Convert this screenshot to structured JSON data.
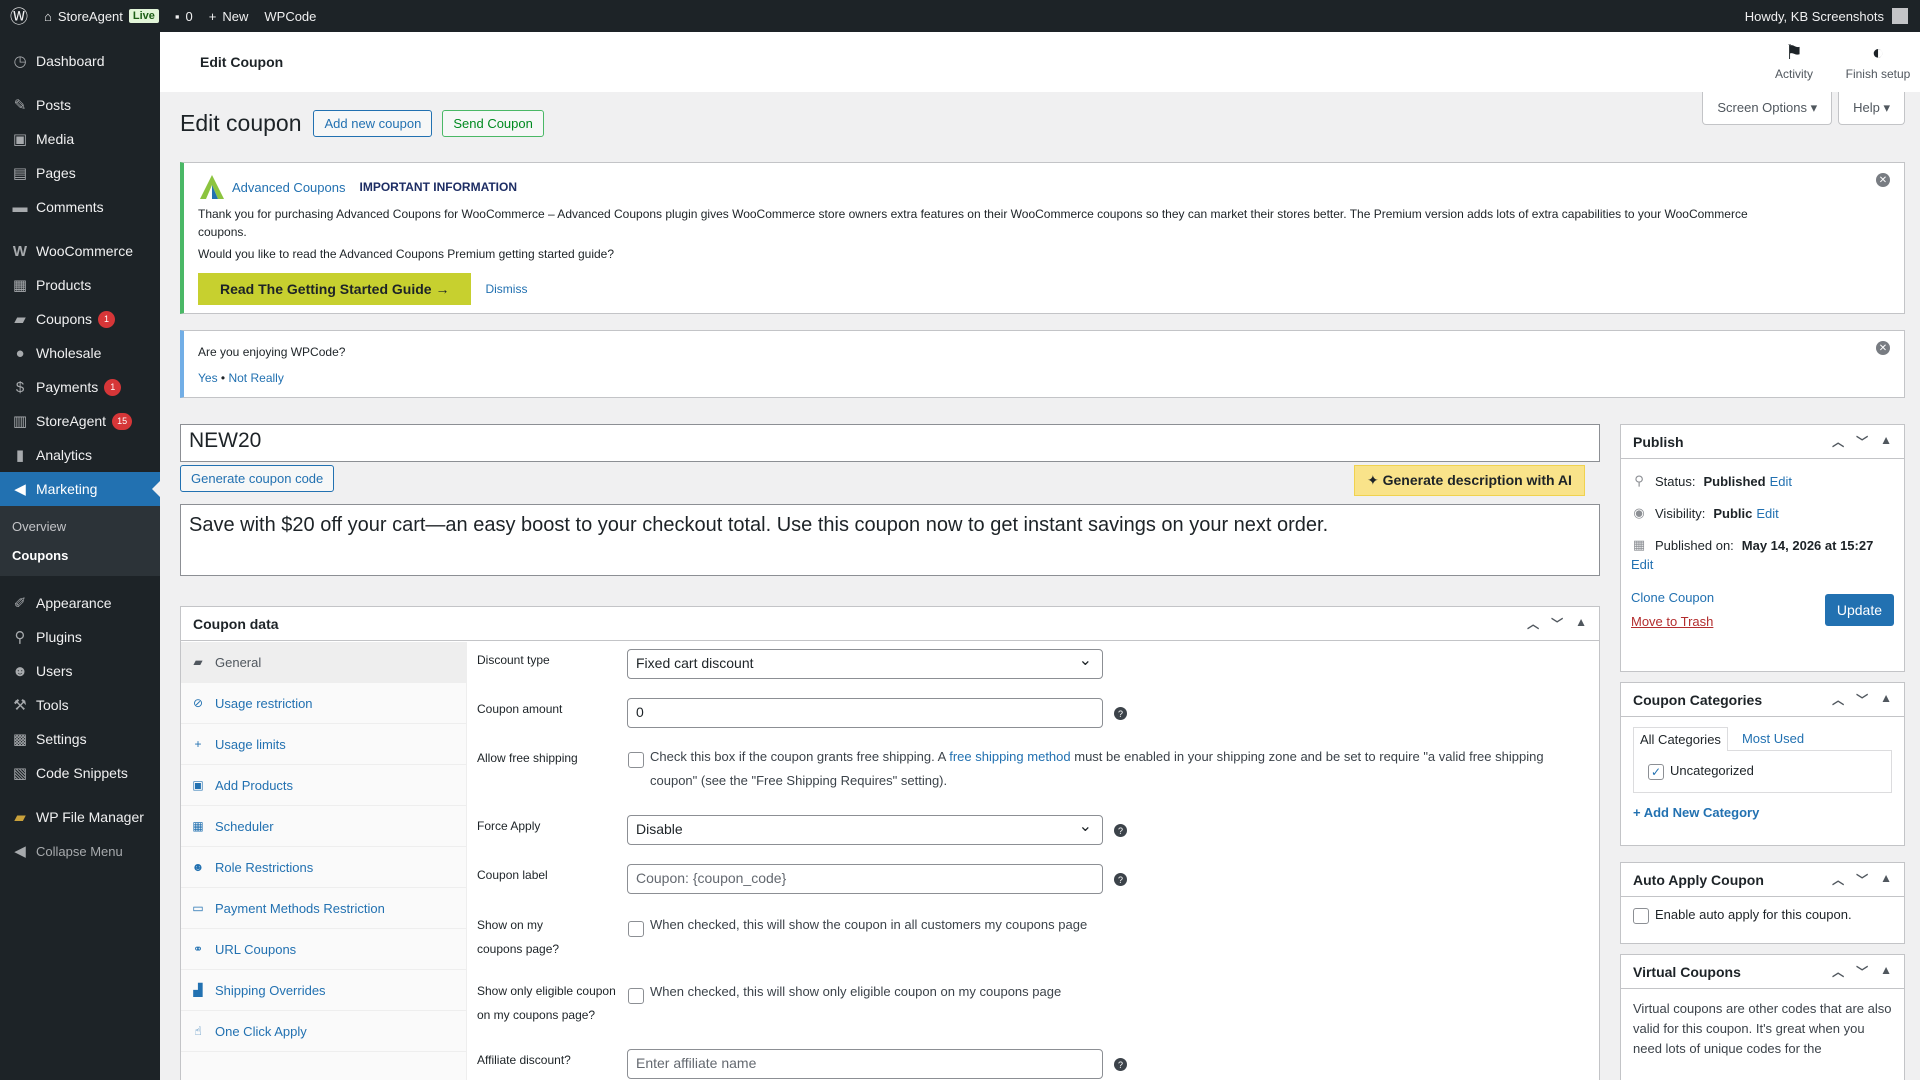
{
  "adminbar": {
    "site_name": "StoreAgent",
    "live_label": "Live",
    "comments_count": "0",
    "new_label": "New",
    "wpcode_label": "WPCode",
    "greeting": "Howdy, KB Screenshots"
  },
  "sidebar": {
    "items": [
      {
        "label": "Dashboard",
        "icon": "dashboard-icon"
      },
      {
        "label": "Posts",
        "icon": "pin-icon"
      },
      {
        "label": "Media",
        "icon": "media-icon"
      },
      {
        "label": "Pages",
        "icon": "page-icon"
      },
      {
        "label": "Comments",
        "icon": "comment-icon"
      },
      {
        "label": "WooCommerce",
        "icon": "woo-icon"
      },
      {
        "label": "Products",
        "icon": "archive-icon"
      },
      {
        "label": "Coupons",
        "icon": "ticket-icon",
        "badge": "1"
      },
      {
        "label": "Wholesale",
        "icon": "wholesale-icon"
      },
      {
        "label": "Payments",
        "icon": "dollar-icon",
        "badge": "1"
      },
      {
        "label": "StoreAgent",
        "icon": "store-icon",
        "badge": "15"
      },
      {
        "label": "Analytics",
        "icon": "bar-chart-icon"
      },
      {
        "label": "Marketing",
        "icon": "megaphone-icon"
      },
      {
        "label": "Appearance",
        "icon": "brush-icon"
      },
      {
        "label": "Plugins",
        "icon": "plug-icon"
      },
      {
        "label": "Users",
        "icon": "user-icon"
      },
      {
        "label": "Tools",
        "icon": "wrench-icon"
      },
      {
        "label": "Settings",
        "icon": "settings-icon"
      },
      {
        "label": "Code Snippets",
        "icon": "code-icon"
      },
      {
        "label": "WP File Manager",
        "icon": "folder-icon"
      },
      {
        "label": "Collapse Menu",
        "icon": "collapse-icon"
      }
    ],
    "submenu": [
      "Overview",
      "Coupons"
    ]
  },
  "header": {
    "title": "Edit Coupon",
    "activity": "Activity",
    "finish_setup": "Finish setup"
  },
  "screen_options": "Screen Options",
  "help": "Help",
  "heading": {
    "title": "Edit coupon",
    "add_new": "Add new coupon",
    "send": "Send Coupon"
  },
  "notice_ac": {
    "brand": "Advanced Coupons",
    "important": "IMPORTANT INFORMATION",
    "text": "Thank you for purchasing Advanced Coupons for WooCommerce – Advanced Coupons plugin gives WooCommerce store owners extra features on their WooCommerce coupons so they can market their stores better. The Premium version adds lots of extra capabilities to your WooCommerce coupons.",
    "question": "Would you like to read the Advanced Coupons Premium getting started guide?",
    "cta": "Read The Getting Started Guide →",
    "dismiss": "Dismiss"
  },
  "notice_wpcode": {
    "question": "Are you enjoying WPCode?",
    "yes": "Yes",
    "sep": "•",
    "no": "Not Really"
  },
  "coupon": {
    "code": "NEW20",
    "generate_code": "Generate coupon code",
    "generate_ai": "Generate description with AI",
    "description": "Save with $20 off your cart—an easy boost to your checkout total. Use this coupon now to get instant savings on your next order."
  },
  "coupon_data": {
    "title": "Coupon data",
    "tabs": [
      {
        "label": "General",
        "icon": "ticket-icon"
      },
      {
        "label": "Usage restriction",
        "icon": "block-icon"
      },
      {
        "label": "Usage limits",
        "icon": "plus-icon"
      },
      {
        "label": "Add Products",
        "icon": "lock-icon"
      },
      {
        "label": "Scheduler",
        "icon": "calendar-icon"
      },
      {
        "label": "Role Restrictions",
        "icon": "user-icon"
      },
      {
        "label": "Payment Methods Restriction",
        "icon": "card-icon"
      },
      {
        "label": "URL Coupons",
        "icon": "link-icon"
      },
      {
        "label": "Shipping Overrides",
        "icon": "truck-icon"
      },
      {
        "label": "One Click Apply",
        "icon": "pointer-icon"
      }
    ],
    "fields": {
      "discount_type_label": "Discount type",
      "discount_type_value": "Fixed cart discount",
      "amount_label": "Coupon amount",
      "amount_value": "0",
      "free_shipping_label": "Allow free shipping",
      "free_shipping_text_a": "Check this box if the coupon grants free shipping. A",
      "free_shipping_link": "free shipping method",
      "free_shipping_text_b": "must be enabled in your shipping zone and be set to require \"a valid free shipping coupon\" (see the \"Free Shipping Requires\" setting).",
      "force_apply_label": "Force Apply",
      "force_apply_value": "Disable",
      "coupon_label_label": "Coupon label",
      "coupon_label_value": "Coupon: {coupon_code}",
      "show_mycoupons_label": "Show on my coupons page?",
      "show_mycoupons_text": "When checked, this will show the coupon in all customers my coupons page",
      "show_eligible_label": "Show only eligible coupon on my coupons page?",
      "show_eligible_text": "When checked, this will show only eligible coupon on my coupons page",
      "affiliate_label": "Affiliate discount?",
      "affiliate_placeholder": "Enter affiliate name"
    }
  },
  "publish": {
    "title": "Publish",
    "status_label": "Status:",
    "status_value": "Published",
    "visibility_label": "Visibility:",
    "visibility_value": "Public",
    "published_label": "Published on:",
    "published_value": "May 14, 2026 at 15:27",
    "edit": "Edit",
    "clone": "Clone Coupon",
    "trash": "Move to Trash",
    "update": "Update"
  },
  "categories": {
    "title": "Coupon Categories",
    "tab_all": "All Categories",
    "tab_used": "Most Used",
    "item": "Uncategorized",
    "add_new": "+ Add New Category"
  },
  "auto_apply": {
    "title": "Auto Apply Coupon",
    "text": "Enable auto apply for this coupon."
  },
  "virtual": {
    "title": "Virtual Coupons",
    "text": "Virtual coupons are other codes that are also valid for this coupon. It's great when you need lots of unique codes for the"
  },
  "colors": {
    "admin_dark": "#1d2327",
    "accent": "#2271b1",
    "cta_yellow": "#c7d02f",
    "badge_red": "#d63638"
  }
}
